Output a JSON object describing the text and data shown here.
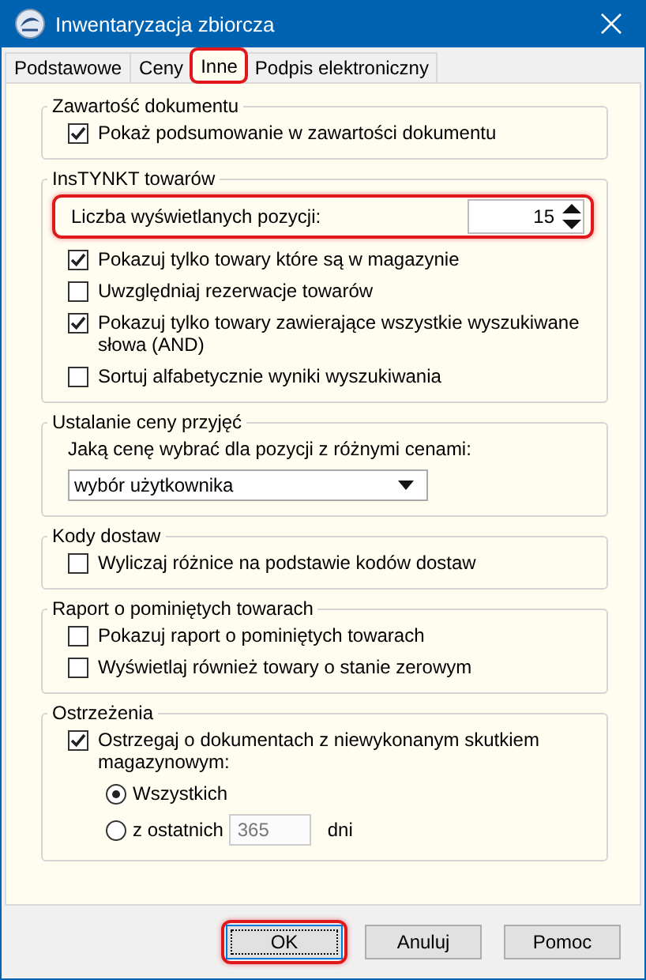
{
  "window": {
    "title": "Inwentaryzacja zbiorcza"
  },
  "tabs": [
    {
      "label": "Podstawowe",
      "selected": false,
      "highlighted": false
    },
    {
      "label": "Ceny",
      "selected": false,
      "highlighted": false
    },
    {
      "label": "Inne",
      "selected": true,
      "highlighted": true
    },
    {
      "label": "Podpis elektroniczny",
      "selected": false,
      "highlighted": false
    }
  ],
  "groups": [
    {
      "title": "Zawartość dokumentu",
      "items": [
        {
          "kind": "checkbox",
          "label": "Pokaż podsumowanie w zawartości dokumentu",
          "checked": true
        }
      ]
    },
    {
      "title": "InsTYNKT towarów",
      "items": [
        {
          "kind": "spinner",
          "label": "Liczba wyświetlanych pozycji:",
          "value": "15",
          "highlighted": true
        },
        {
          "kind": "checkbox",
          "label": "Pokazuj tylko towary które są w magazynie",
          "checked": true
        },
        {
          "kind": "checkbox",
          "label": "Uwzględniaj rezerwacje towarów",
          "checked": false
        },
        {
          "kind": "checkbox",
          "label": "Pokazuj tylko towary zawierające wszystkie wyszukiwane słowa (AND)",
          "checked": true
        },
        {
          "kind": "checkbox",
          "label": "Sortuj alfabetycznie wyniki wyszukiwania",
          "checked": false
        }
      ]
    },
    {
      "title": "Ustalanie ceny przyjęć",
      "items": [
        {
          "kind": "label",
          "text": "Jaką cenę wybrać dla pozycji z różnymi cenami:"
        },
        {
          "kind": "dropdown",
          "value": "wybór użytkownika"
        }
      ]
    },
    {
      "title": "Kody dostaw",
      "items": [
        {
          "kind": "checkbox",
          "label": "Wyliczaj różnice na podstawie kodów dostaw",
          "checked": false
        }
      ]
    },
    {
      "title": "Raport o pominiętych towarach",
      "items": [
        {
          "kind": "checkbox",
          "label": "Pokazuj raport o pominiętych towarach",
          "checked": false
        },
        {
          "kind": "checkbox",
          "label": "Wyświetlaj również towary o stanie zerowym",
          "checked": false
        }
      ]
    },
    {
      "title": "Ostrzeżenia",
      "items": [
        {
          "kind": "checkbox",
          "label": "Ostrzegaj o dokumentach z niewykonanym skutkiem magazynowym:",
          "checked": true
        },
        {
          "kind": "radio",
          "label": "Wszystkich",
          "selected": true
        },
        {
          "kind": "radio",
          "label": "z ostatnich",
          "selected": false,
          "field": {
            "value": "365",
            "disabled": true
          },
          "suffix": "dni"
        }
      ]
    }
  ],
  "buttons": [
    {
      "label": "OK",
      "highlighted": true,
      "default": true
    },
    {
      "label": "Anuluj",
      "highlighted": false,
      "default": false
    },
    {
      "label": "Pomoc",
      "highlighted": false,
      "default": false
    }
  ]
}
